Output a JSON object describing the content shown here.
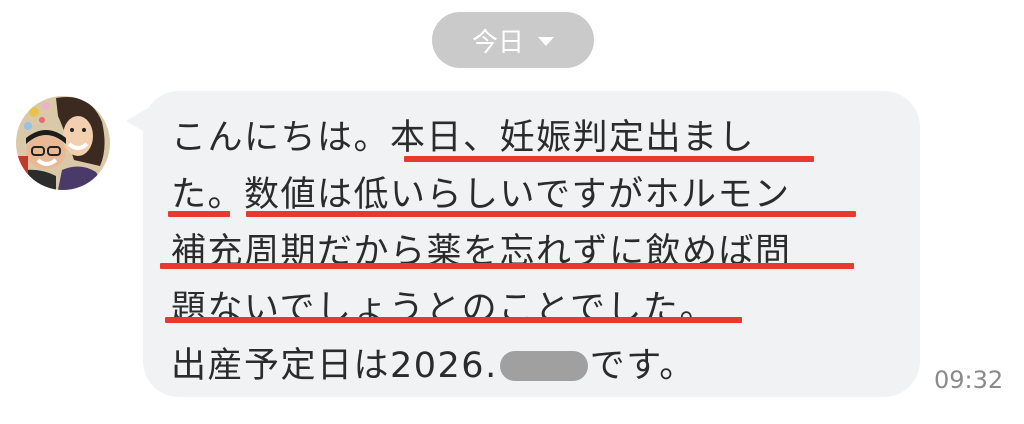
{
  "date_divider": {
    "label": "今日",
    "icon": "chevron-down-icon"
  },
  "message": {
    "lines": [
      "こんにちは。本日、妊娠判定出まし",
      "た。数値は低いらしいですがホルモン",
      "補充周期だから薬を忘れずに飲めば問",
      "題ないでしょうとのことでした。"
    ],
    "last_line_prefix": "出産予定日は2026.",
    "last_line_suffix": "です。",
    "redaction_color": "#a0a0a0",
    "timestamp": "09:32",
    "highlight_color": "#e8392f"
  },
  "colors": {
    "bubble_background": "#f1f2f4",
    "date_pill_background": "#cacaca",
    "text": "#2b2b2b",
    "timestamp_text": "#8a8a8a"
  }
}
